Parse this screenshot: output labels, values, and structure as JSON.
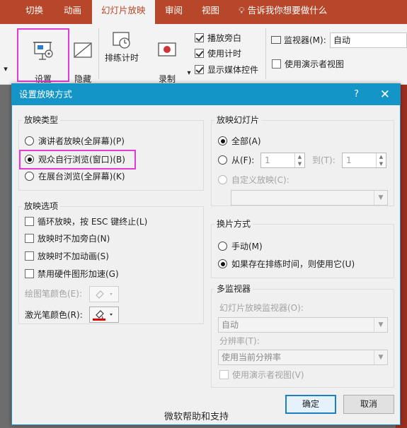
{
  "ribbon": {
    "tabs": [
      "切换",
      "动画",
      "幻灯片放映",
      "审阅",
      "视图"
    ],
    "tell_me": "告诉我你想要做什么",
    "buttons": {
      "setup": "设置\n幻灯片放映",
      "hide": "隐藏\n幻灯片",
      "rehearse": "排练计时",
      "record": "录制\n幻灯片演示"
    },
    "checkboxes": [
      {
        "label": "播放旁白",
        "checked": true
      },
      {
        "label": "使用计时",
        "checked": true
      },
      {
        "label": "显示媒体控件",
        "checked": true
      }
    ],
    "monitor_label": "监视器(M):",
    "monitor_value": "自动",
    "presenter_view_label": "使用演示者视图",
    "presenter_view_checked": false
  },
  "dialog": {
    "title": "设置放映方式",
    "help": "?",
    "show_type": {
      "label": "放映类型",
      "options": [
        {
          "label": "演讲者放映(全屏幕)(P)",
          "selected": false
        },
        {
          "label": "观众自行浏览(窗口)(B)",
          "selected": true
        },
        {
          "label": "在展台浏览(全屏幕)(K)",
          "selected": false
        }
      ]
    },
    "show_options": {
      "label": "放映选项",
      "checkboxes": [
        {
          "label": "循环放映，按 ESC 键终止(L)",
          "checked": false
        },
        {
          "label": "放映时不加旁白(N)",
          "checked": false
        },
        {
          "label": "放映时不加动画(S)",
          "checked": false
        },
        {
          "label": "禁用硬件图形加速(G)",
          "checked": false
        }
      ],
      "pen_color_label": "绘图笔颜色(E):",
      "laser_color_label": "激光笔颜色(R):",
      "laser_color": "#e00000"
    },
    "show_slides": {
      "label": "放映幻灯片",
      "all_label": "全部(A)",
      "from_label": "从(F):",
      "from_value": "1",
      "to_label": "到(T):",
      "to_value": "1",
      "custom_label": "自定义放映(C):",
      "custom_value": ""
    },
    "advance": {
      "label": "换片方式",
      "manual_label": "手动(M)",
      "timing_label": "如果存在排练时间，则使用它(U)"
    },
    "multi_monitor": {
      "label": "多监视器",
      "monitor_label": "幻灯片放映监视器(O):",
      "monitor_value": "自动",
      "resolution_label": "分辨率(T):",
      "resolution_value": "使用当前分辨率",
      "presenter_view_label": "使用演示者视图(V)"
    },
    "ok_label": "确定",
    "cancel_label": "取消"
  },
  "watermark": "微软帮助和支持"
}
